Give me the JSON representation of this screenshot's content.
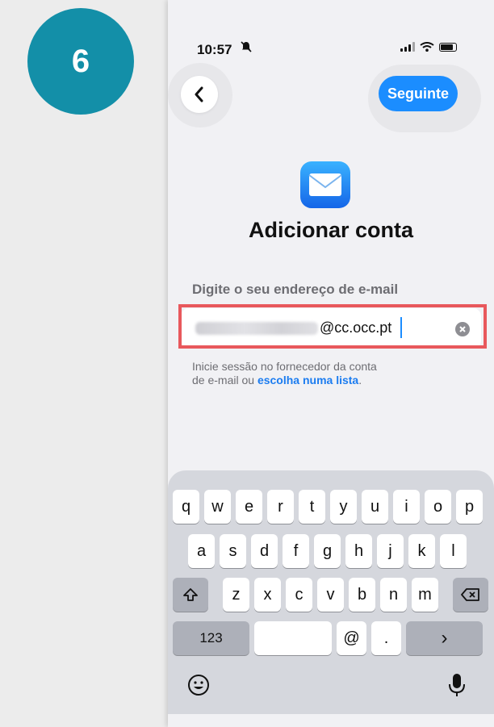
{
  "step": {
    "number": "6"
  },
  "status_bar": {
    "time": "10:57"
  },
  "nav": {
    "next_label": "Seguinte"
  },
  "header": {
    "title": "Adicionar conta"
  },
  "email": {
    "label": "Digite o seu endereço de e-mail",
    "value_visible_part": "@cc.occ.pt"
  },
  "hint": {
    "text_before": "Inicie sessão no fornecedor da conta",
    "text_line2": "de e-mail ou ",
    "link": "escolha numa lista",
    "after_link": "."
  },
  "keyboard": {
    "row1": [
      "q",
      "w",
      "e",
      "r",
      "t",
      "y",
      "u",
      "i",
      "o",
      "p"
    ],
    "row2": [
      "a",
      "s",
      "d",
      "f",
      "g",
      "h",
      "j",
      "k",
      "l"
    ],
    "row3": [
      "z",
      "x",
      "c",
      "v",
      "b",
      "n",
      "m"
    ],
    "numbers_label": "123",
    "at_label": "@",
    "dot_label": ".",
    "go_label": "›"
  },
  "colors": {
    "accent": "#1b8dff",
    "badge": "#138fa8",
    "highlight": "#e8585c"
  }
}
